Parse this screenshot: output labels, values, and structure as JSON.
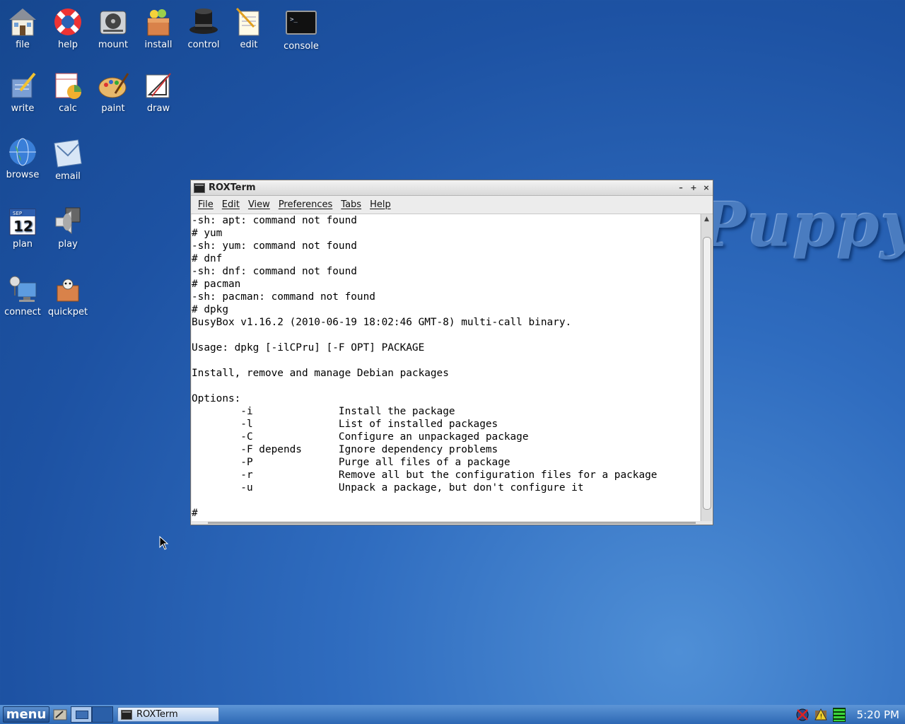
{
  "desktop": {
    "watermark": "Puppy",
    "icons": [
      {
        "label": "file",
        "icon": "house-icon"
      },
      {
        "label": "help",
        "icon": "lifebuoy-icon"
      },
      {
        "label": "mount",
        "icon": "harddrive-icon"
      },
      {
        "label": "install",
        "icon": "package-icon"
      },
      {
        "label": "control",
        "icon": "top-hat-icon"
      },
      {
        "label": "edit",
        "icon": "notepad-icon"
      },
      {
        "label": "console",
        "icon": "terminal-icon"
      },
      {
        "label": "write",
        "icon": "write-icon"
      },
      {
        "label": "calc",
        "icon": "spreadsheet-icon"
      },
      {
        "label": "paint",
        "icon": "palette-icon"
      },
      {
        "label": "draw",
        "icon": "drawing-icon"
      },
      {
        "label": "browse",
        "icon": "globe-icon"
      },
      {
        "label": "email",
        "icon": "mail-icon"
      },
      {
        "label": "plan",
        "icon": "calendar-icon",
        "day": "12",
        "month": "SEP"
      },
      {
        "label": "play",
        "icon": "speaker-icon"
      },
      {
        "label": "connect",
        "icon": "network-icon"
      },
      {
        "label": "quickpet",
        "icon": "pet-box-icon"
      }
    ]
  },
  "window": {
    "title": "ROXTerm",
    "controls": {
      "minimize": "–",
      "maximize": "+",
      "close": "×"
    },
    "menu": [
      "File",
      "Edit",
      "View",
      "Preferences",
      "Tabs",
      "Help"
    ],
    "terminal_lines": [
      "-sh: apt: command not found",
      "# yum",
      "-sh: yum: command not found",
      "# dnf",
      "-sh: dnf: command not found",
      "# pacman",
      "-sh: pacman: command not found",
      "# dpkg",
      "BusyBox v1.16.2 (2010-06-19 18:02:46 GMT-8) multi-call binary.",
      "",
      "Usage: dpkg [-ilCPru] [-F OPT] PACKAGE",
      "",
      "Install, remove and manage Debian packages",
      "",
      "Options:",
      "        -i              Install the package",
      "        -l              List of installed packages",
      "        -C              Configure an unpackaged package",
      "        -F depends      Ignore dependency problems",
      "        -P              Purge all files of a package",
      "        -r              Remove all but the configuration files for a package",
      "        -u              Unpack a package, but don't configure it",
      "",
      "#"
    ]
  },
  "taskbar": {
    "menu_label": "menu",
    "task_label": "ROXTerm",
    "clock": "5:20 PM"
  }
}
